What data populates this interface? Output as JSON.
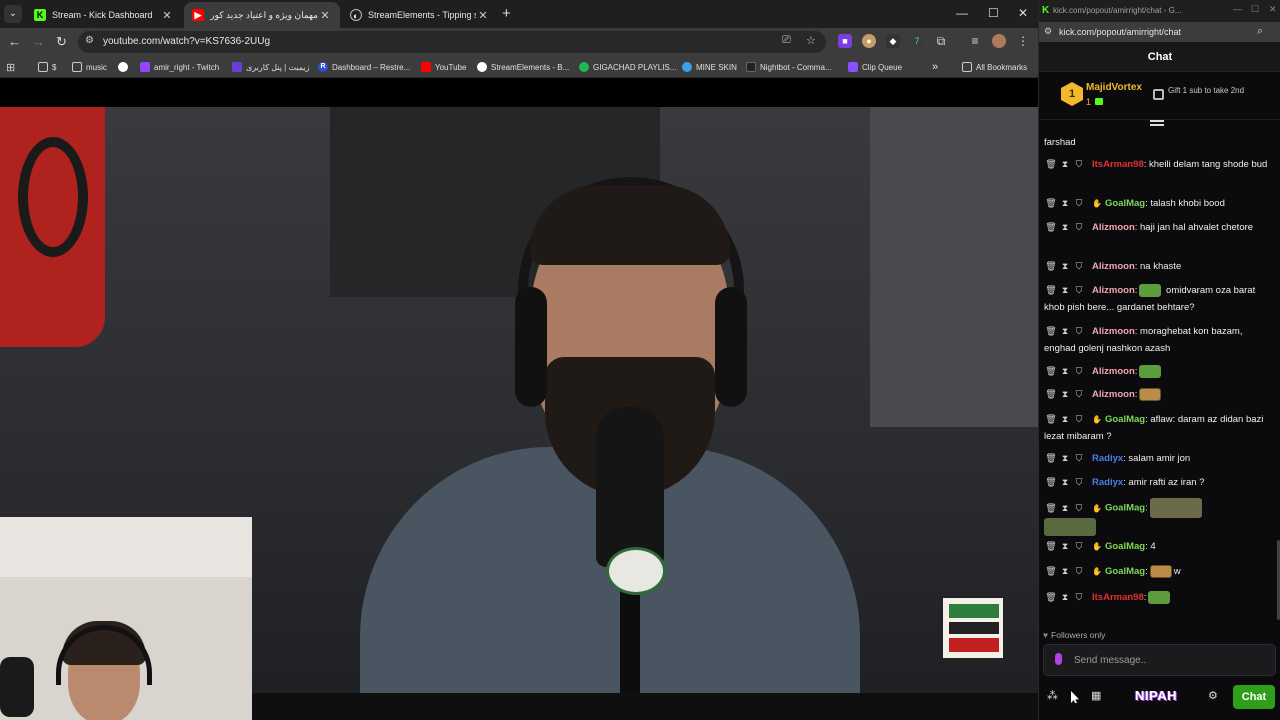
{
  "browser": {
    "tabs": [
      {
        "label": "Stream - Kick Dashboard",
        "active": false
      },
      {
        "label": "مهمان ویژه و اعتیاد جدید کور",
        "active": true
      },
      {
        "label": "StreamElements - Tipping setti",
        "active": false
      }
    ],
    "url": "youtube.com/watch?v=KS7636-2UUg",
    "bookmarks": [
      "$",
      "music",
      "amir_right - Twitch",
      "زیمبت | پنل کاربری",
      "Dashboard – Restre...",
      "YouTube",
      "StreamElements - B...",
      "GIGACHAD PLAYLIS...",
      "MINE SKIN",
      "Nightbot - Comma...",
      "Clip Queue",
      "All Bookmarks"
    ],
    "bookmarks_more": "»"
  },
  "icons": {
    "tab_list": "chevron-down-icon",
    "close": "close-icon",
    "new_tab": "plus-icon",
    "back": "arrow-left-icon",
    "forward": "arrow-right-icon",
    "reload": "reload-icon",
    "apps": "apps-grid-icon",
    "folder": "folder-icon"
  },
  "chat_window": {
    "title": "kick.com/popout/amirright/chat - G...",
    "url": "kick.com/popout/amirright/chat",
    "header": "Chat",
    "pinned": {
      "rank": "1",
      "name": "MajidVortex",
      "count": "1",
      "gift_text": "Gift 1 sub to take 2nd"
    },
    "messages": [
      {
        "name": "",
        "color": "#efefef",
        "text": "farshad",
        "badges": false
      },
      {
        "name": "ItsArman98",
        "color": "#e0312f",
        "text": ": kheili delam tang shode bud",
        "badges": true
      },
      {
        "name": "GoalMag",
        "color": "#7ed957",
        "text": ": talash khobi bood",
        "badges": true
      },
      {
        "name": "Alizmoon",
        "color": "#f3a7b3",
        "text": ": haji jan hal ahvalet chetore",
        "badges": true
      },
      {
        "name": "Alizmoon",
        "color": "#f3a7b3",
        "text": ": na khaste",
        "badges": true
      },
      {
        "name": "Alizmoon",
        "color": "#f3a7b3",
        "text": " omidvaram oza barat khob pish bere... gardanet behtare?",
        "badges": true
      },
      {
        "name": "Alizmoon",
        "color": "#f3a7b3",
        "text": ": moraghebat kon bazam, enghad golenj nashkon azash",
        "badges": true
      },
      {
        "name": "Alizmoon",
        "color": "#f3a7b3",
        "text": ":",
        "badges": true
      },
      {
        "name": "Alizmoon",
        "color": "#f3a7b3",
        "text": ":",
        "badges": true
      },
      {
        "name": "GoalMag",
        "color": "#7ed957",
        "text": ": aflaw: daram az didan bazi lezat mibaram ?",
        "badges": true
      },
      {
        "name": "Radiyx",
        "color": "#4a7fe8",
        "text": ": salam amir jon",
        "badges": true
      },
      {
        "name": "Radiyx",
        "color": "#4a7fe8",
        "text": ": amir rafti az iran ?",
        "badges": true
      },
      {
        "name": "GoalMag",
        "color": "#7ed957",
        "text": ":",
        "badges": true
      },
      {
        "name": "GoalMag",
        "color": "#7ed957",
        "text": ": 4",
        "badges": true
      },
      {
        "name": "GoalMag",
        "color": "#7ed957",
        "text": ":",
        "badges": true
      },
      {
        "name": "ItsArman98",
        "color": "#e0312f",
        "text": ":",
        "badges": true
      }
    ],
    "emote_w": "w",
    "followers_only": "Followers only",
    "send_placeholder": "Send message..",
    "nipah_label": "NIPAH",
    "chat_button": "Chat"
  }
}
